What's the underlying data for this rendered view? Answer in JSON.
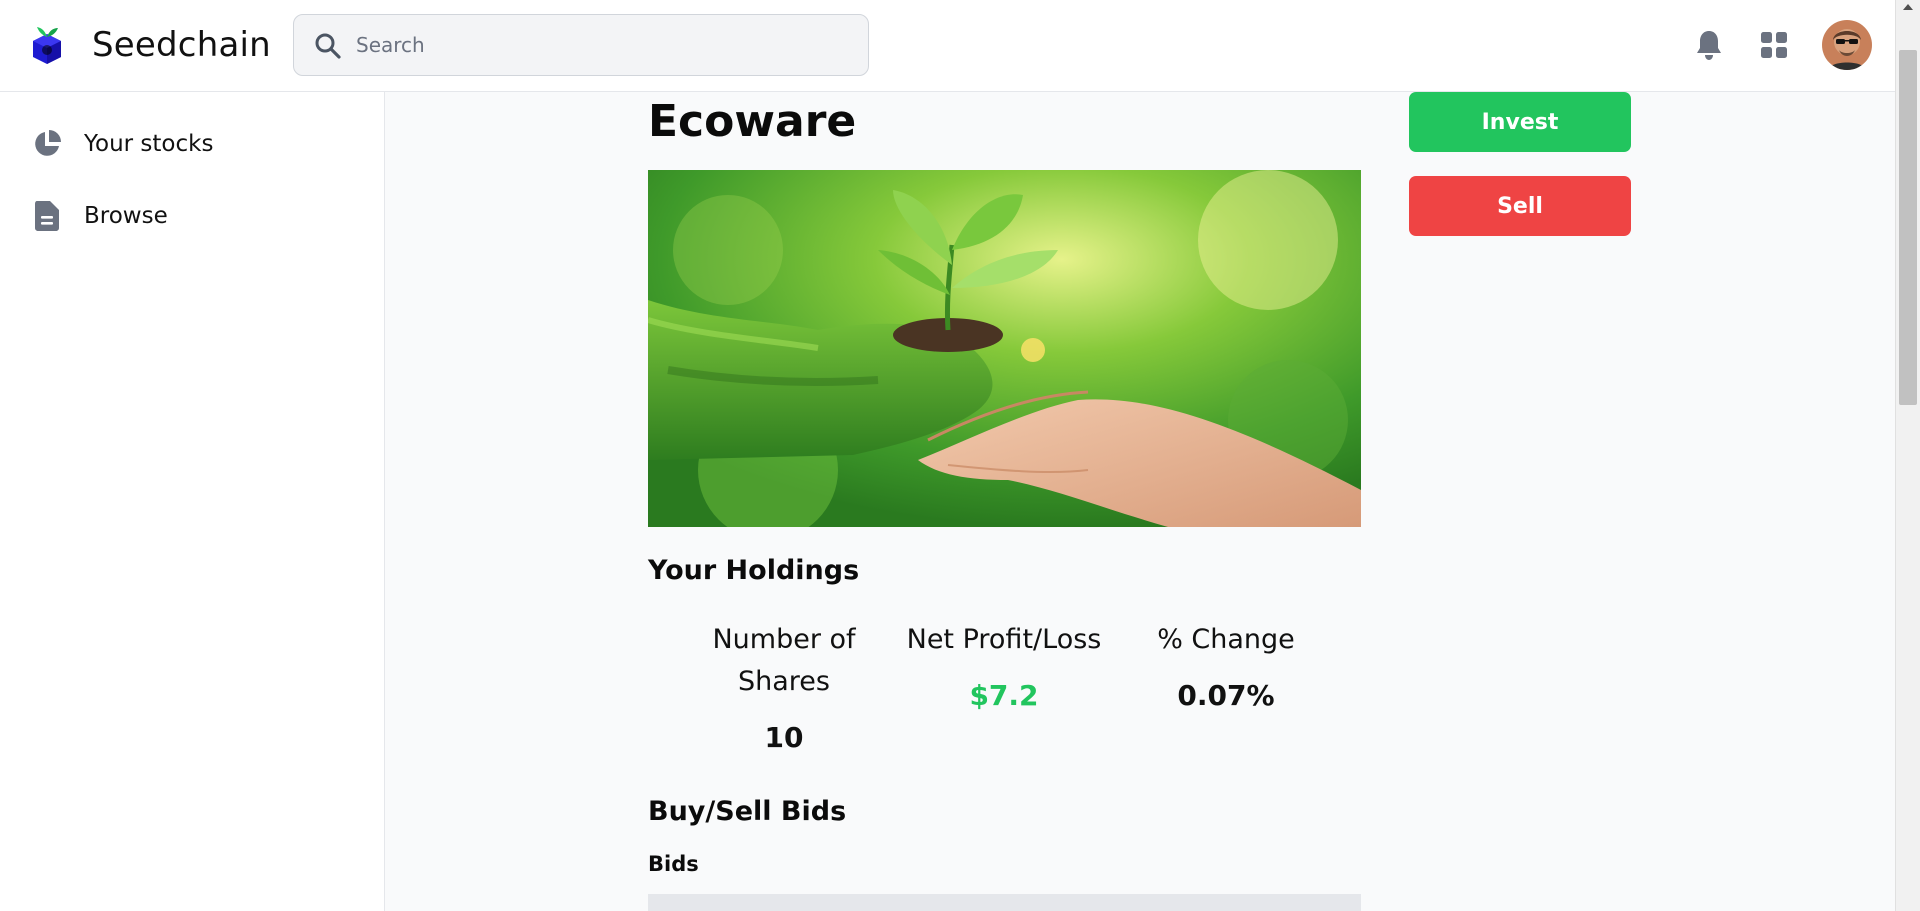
{
  "header": {
    "brand_name": "Seedchain",
    "search_placeholder": "Search"
  },
  "sidebar": {
    "items": [
      {
        "label": "Your stocks",
        "icon": "pie-chart-icon"
      },
      {
        "label": "Browse",
        "icon": "document-icon"
      }
    ]
  },
  "main": {
    "title": "Ecoware",
    "hero_alt": "Ecoware",
    "actions": {
      "invest_label": "Invest",
      "sell_label": "Sell"
    },
    "holdings": {
      "heading": "Your Holdings",
      "stats": [
        {
          "label": "Number of Shares",
          "value": "10"
        },
        {
          "label": "Net Profit/Loss",
          "value": "$7.2"
        },
        {
          "label": "% Change",
          "value": "0.07%"
        }
      ]
    },
    "bids": {
      "heading": "Buy/Sell Bids",
      "subheading": "Bids"
    }
  },
  "colors": {
    "invest": "#22c55e",
    "sell": "#ef4444",
    "profit_positive": "#22c55e",
    "brand_logo": "#1e1bd1"
  }
}
